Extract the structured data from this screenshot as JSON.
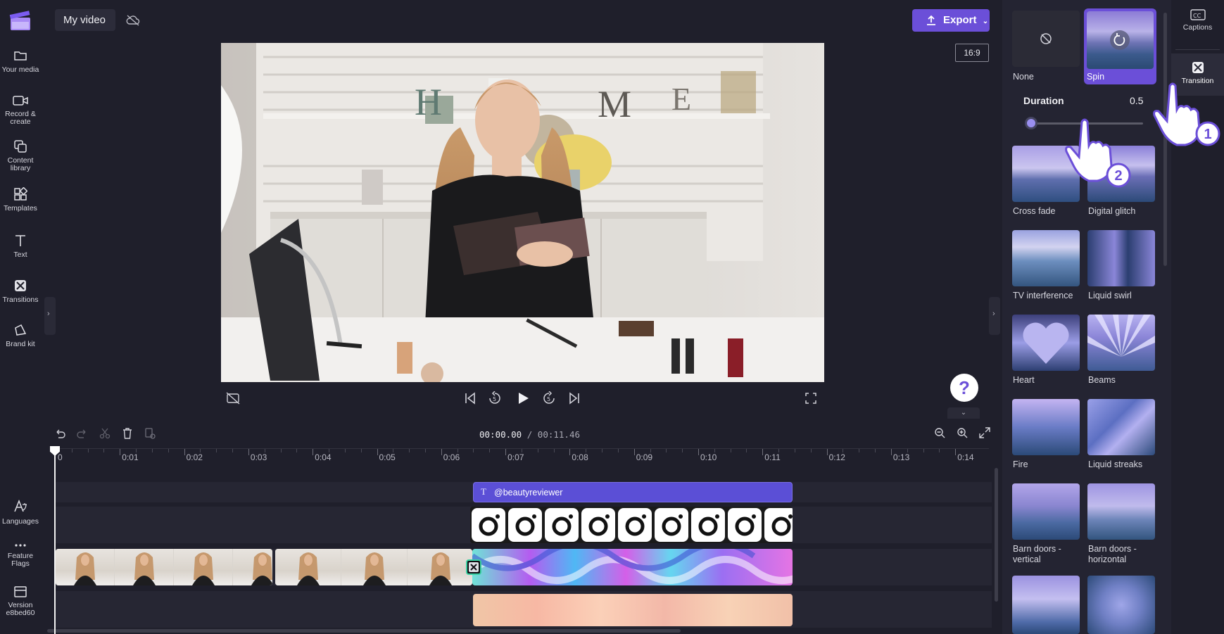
{
  "app": {
    "project_title": "My video",
    "export_label": "Export",
    "aspect_ratio": "16:9",
    "help_glyph": "?"
  },
  "leftnav": {
    "items": [
      {
        "label": "Your media",
        "icon": "folder-icon"
      },
      {
        "label": "Record &",
        "label2": "create",
        "icon": "video-camera-icon"
      },
      {
        "label": "Content",
        "label2": "library",
        "icon": "content-library-icon"
      },
      {
        "label": "Templates",
        "icon": "templates-icon"
      },
      {
        "label": "Text",
        "icon": "text-icon"
      },
      {
        "label": "Transitions",
        "icon": "transitions-icon"
      },
      {
        "label": "Brand kit",
        "icon": "brand-kit-icon"
      }
    ],
    "bottom": [
      {
        "label": "Languages",
        "icon": "languages-icon"
      },
      {
        "label": "Feature",
        "label2": "Flags",
        "icon": "more-icon"
      },
      {
        "label": "Version",
        "label2": "e8bed60",
        "icon": "version-icon"
      }
    ]
  },
  "timeline": {
    "current_time": "00:00.00",
    "total_time": "00:11.46",
    "ticks": [
      "0",
      "0:01",
      "0:02",
      "0:03",
      "0:04",
      "0:05",
      "0:06",
      "0:07",
      "0:08",
      "0:09",
      "0:10",
      "0:11",
      "0:12",
      "0:13",
      "0:14"
    ],
    "text_clip_label": "@beautyreviewer"
  },
  "panel": {
    "none_label": "None",
    "spin_label": "Spin",
    "duration_label": "Duration",
    "duration_value": "0.5",
    "transitions": [
      {
        "label": "Cross fade"
      },
      {
        "label": "Digital glitch"
      },
      {
        "label": "TV interference"
      },
      {
        "label": "Liquid swirl"
      },
      {
        "label": "Heart"
      },
      {
        "label": "Beams"
      },
      {
        "label": "Fire"
      },
      {
        "label": "Liquid streaks"
      },
      {
        "label": "Barn doors -",
        "label2": "vertical"
      },
      {
        "label": "Barn doors -",
        "label2": "horizontal"
      }
    ]
  },
  "righttabs": {
    "captions": "Captions",
    "transition": "Transition"
  },
  "callouts": {
    "one": "1",
    "two": "2"
  },
  "colors": {
    "accent": "#6b4fd8",
    "background": "#1f1f2b",
    "panel": "#242432",
    "text_clip": "#5b4fd6"
  }
}
